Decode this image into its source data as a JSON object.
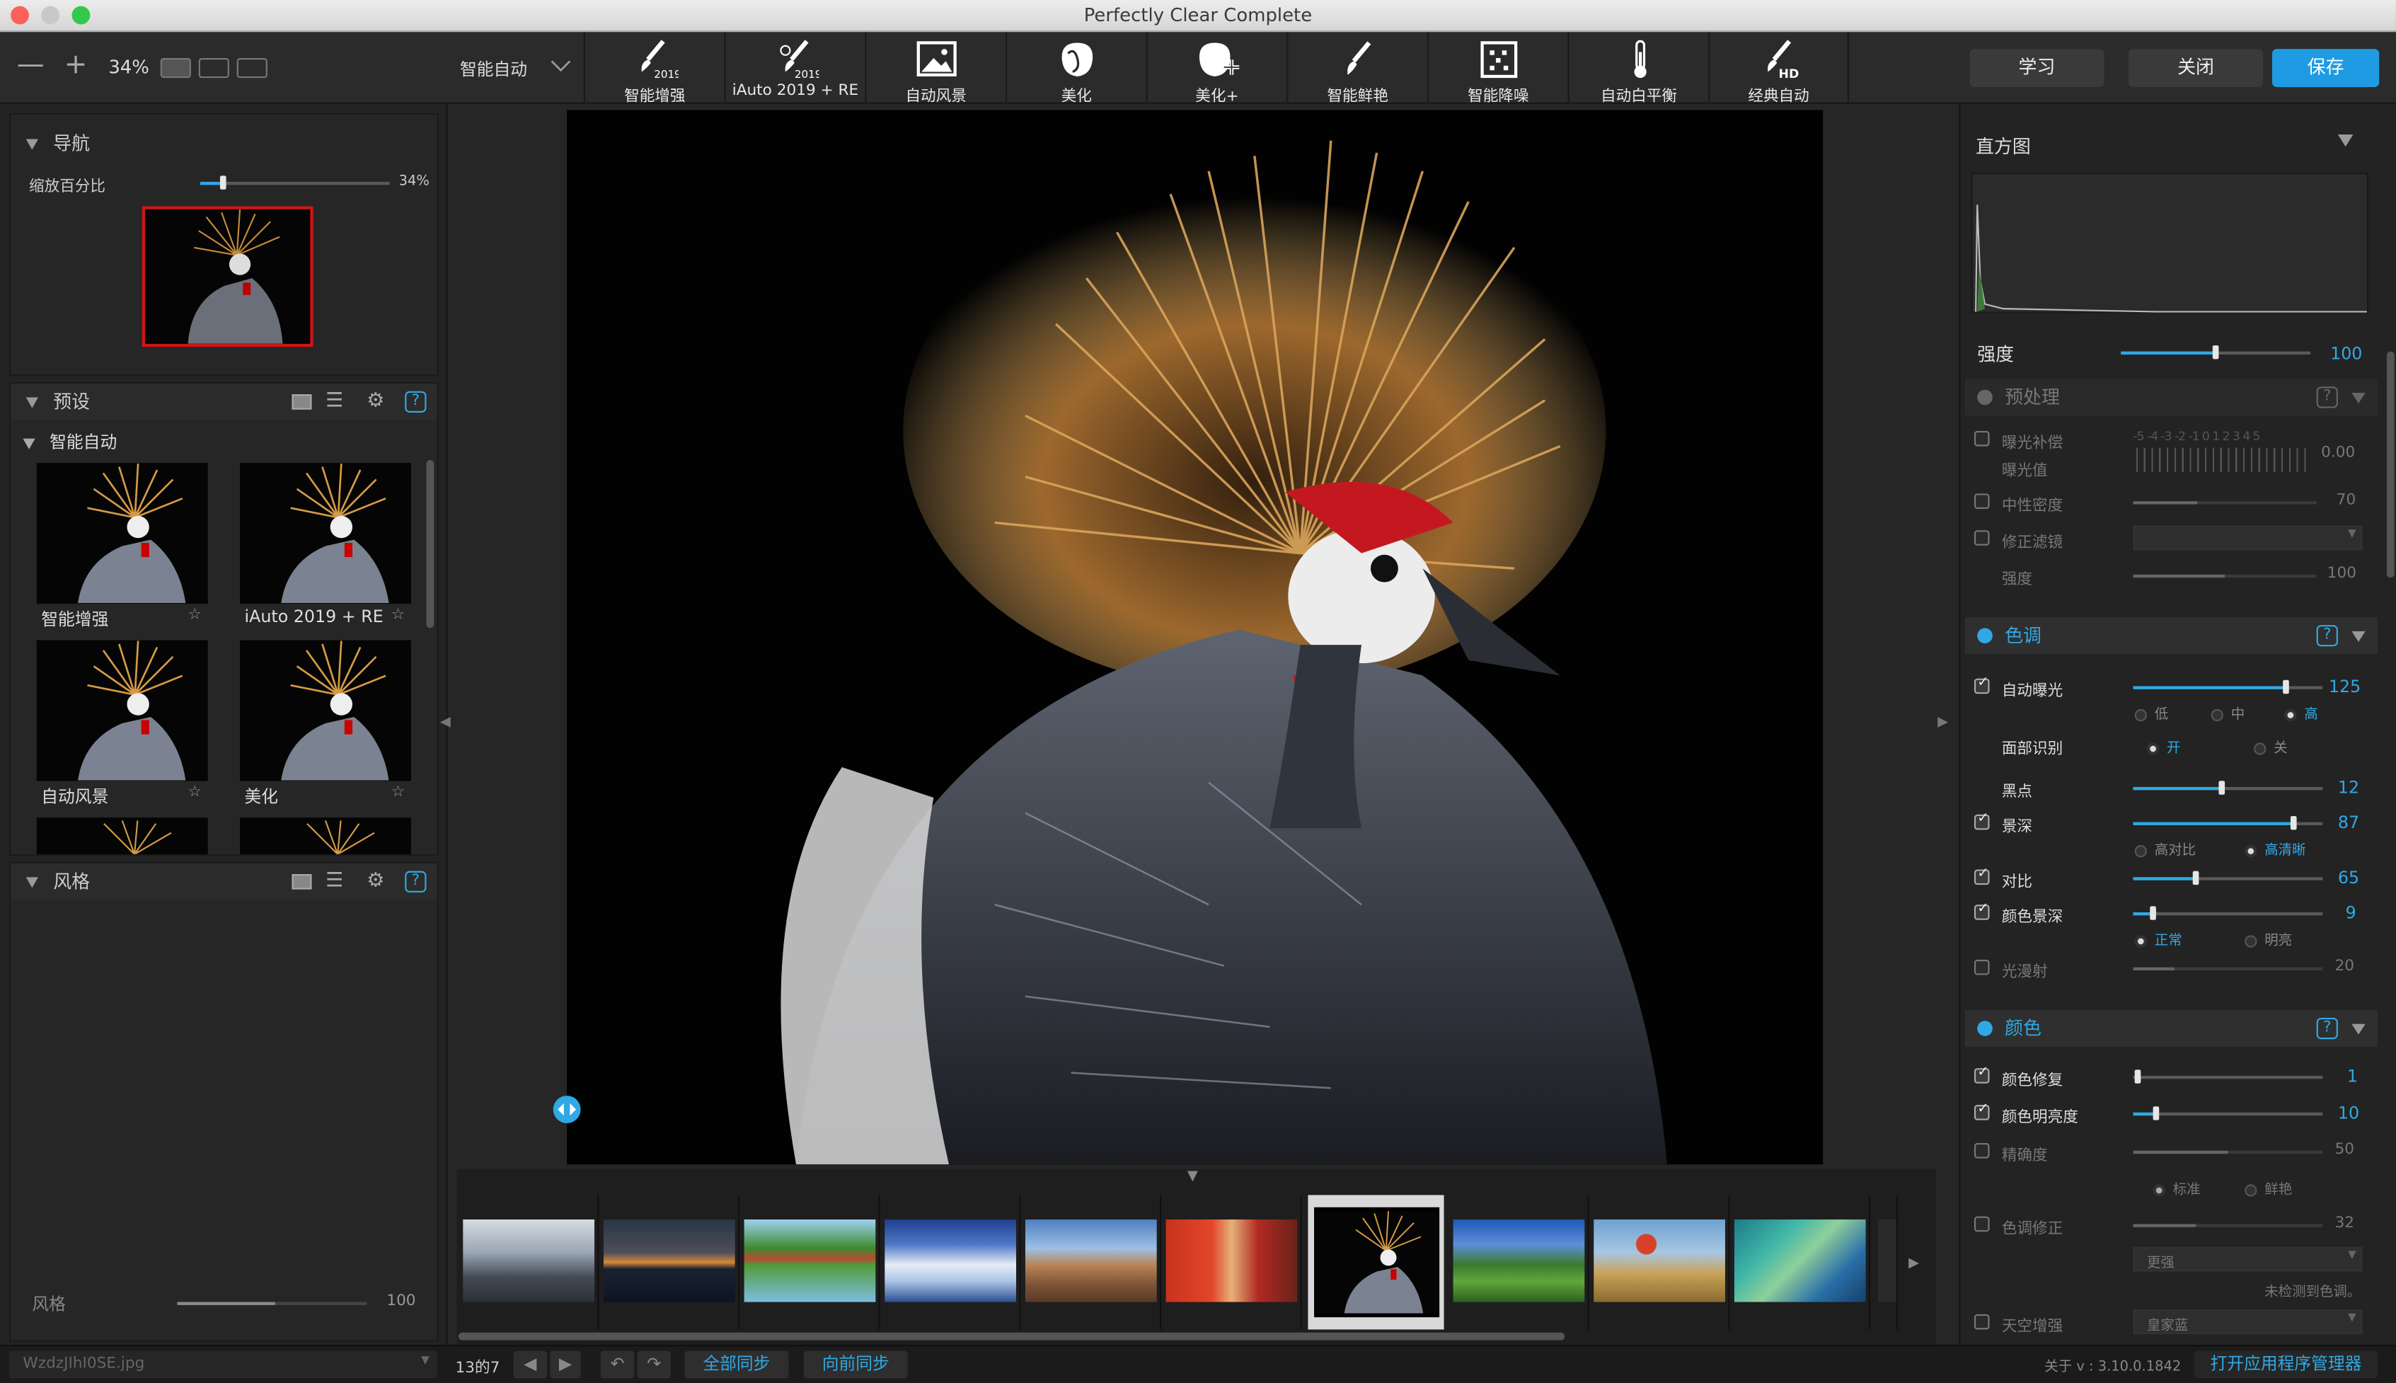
{
  "window": {
    "title": "Perfectly Clear Complete"
  },
  "toolbar": {
    "zoom_out": "—",
    "zoom_in": "+",
    "zoom_value": "34%",
    "preset_dropdown": "智能自动",
    "tools": [
      {
        "label": "智能增强",
        "icon": "brush-2019-icon"
      },
      {
        "label": "iAuto 2019 + RE",
        "icon": "brush-2019-eye-icon"
      },
      {
        "label": "自动风景",
        "icon": "landscape-icon"
      },
      {
        "label": "美化",
        "icon": "face-icon"
      },
      {
        "label": "美化+",
        "icon": "face-plus-icon"
      },
      {
        "label": "智能鲜艳",
        "icon": "brush-icon"
      },
      {
        "label": "智能降噪",
        "icon": "noise-grid-icon"
      },
      {
        "label": "自动白平衡",
        "icon": "thermometer-icon"
      },
      {
        "label": "经典自动",
        "icon": "brush-hd-icon"
      }
    ],
    "learn": "学习",
    "close": "关闭",
    "save": "保存"
  },
  "navigator": {
    "title": "导航",
    "zoom_label": "缩放百分比",
    "zoom_value": "34%",
    "zoom_fraction": 0.12
  },
  "presets": {
    "title": "预设",
    "group": "智能自动",
    "items": [
      {
        "label": "智能增强"
      },
      {
        "label": "iAuto 2019 + RE"
      },
      {
        "label": "自动风景"
      },
      {
        "label": "美化"
      }
    ],
    "help": "?"
  },
  "styles": {
    "title": "风格",
    "help": "?",
    "strength_label": "风格",
    "strength_value": "100"
  },
  "histogram": {
    "title": "直方图"
  },
  "strength": {
    "label": "强度",
    "value": "100",
    "fraction": 0.5
  },
  "preprocess": {
    "title": "预处理",
    "help": "?",
    "exposure_label": "曝光补偿",
    "exposure_sub": "曝光值",
    "exposure_scale": "-5 -4 -3 -2 -1  0  1  2  3  4  5",
    "exposure_value": "0.00",
    "neutral_density_label": "中性密度",
    "neutral_density_value": "70",
    "correction_filter_label": "修正滤镜",
    "strength_label": "强度",
    "strength_value": "100"
  },
  "tone": {
    "title": "色调",
    "help": "?",
    "auto_exposure": {
      "label": "自动曝光",
      "value": "125",
      "fraction": 0.82
    },
    "exposure_modes": [
      "低",
      "中",
      "高"
    ],
    "face_detection": {
      "label": "面部识别",
      "on": "开",
      "off": "关"
    },
    "black_point": {
      "label": "黑点",
      "value": "12",
      "fraction": 0.47
    },
    "depth": {
      "label": "景深",
      "value": "87",
      "fraction": 0.85
    },
    "depth_modes": [
      "高对比",
      "高清晰"
    ],
    "contrast": {
      "label": "对比",
      "value": "65",
      "fraction": 0.33
    },
    "color_depth": {
      "label": "颜色景深",
      "value": "9",
      "fraction": 0.1
    },
    "color_depth_modes": [
      "正常",
      "明亮"
    ],
    "diffuse": {
      "label": "光漫射",
      "value": "20",
      "fraction": 0.22
    }
  },
  "color": {
    "title": "颜色",
    "help": "?",
    "color_restore": {
      "label": "颜色修复",
      "value": "1",
      "fraction": 0.02
    },
    "color_vibrancy": {
      "label": "颜色明亮度",
      "value": "10",
      "fraction": 0.12
    },
    "accuracy": {
      "label": "精确度",
      "value": "50",
      "fraction": 0.5
    },
    "accuracy_modes": [
      "标准",
      "鲜艳"
    ],
    "tint_correction": {
      "label": "色调修正",
      "value": "32",
      "fraction": 0.33
    },
    "more_select": "更强",
    "no_tint_detected": "未检测到色调。",
    "sky_enhance": {
      "label": "天空增强",
      "select": "皇家蓝"
    }
  },
  "filmstrip": {
    "count": 10,
    "selected_index": 6
  },
  "status": {
    "filename": "WzdzJIhI0SE.jpg",
    "counter": "13的7",
    "sync_all": "全部同步",
    "sync_forward": "向前同步",
    "version": "关于 v : 3.10.0.1842",
    "open_manager": "打开应用程序管理器"
  },
  "colors": {
    "accent": "#2fa9e5",
    "save_button": "#1e9be3",
    "nav_frame": "#d01515"
  }
}
